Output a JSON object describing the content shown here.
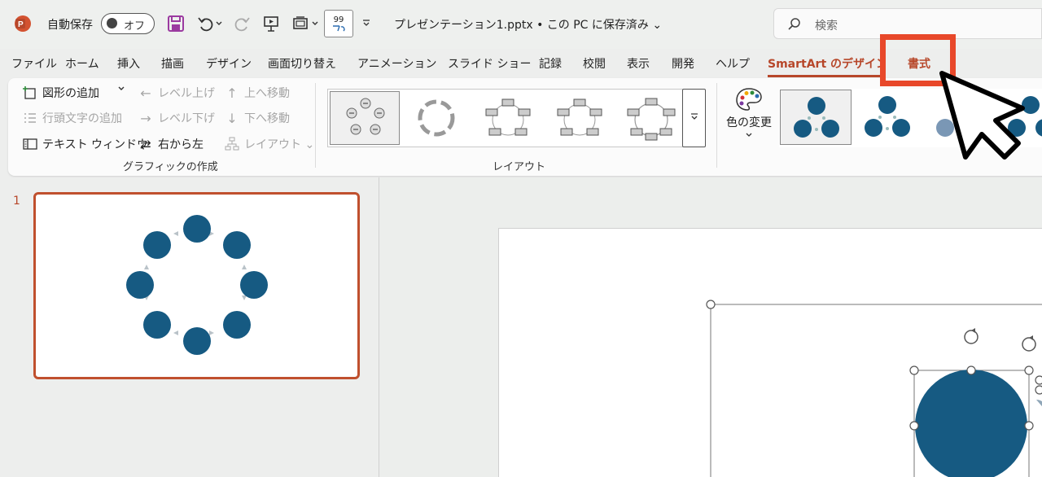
{
  "titlebar": {
    "autosave_label": "自動保存",
    "autosave_state": "オフ",
    "format_painter_label": "99",
    "filename": "プレゼンテーション1.pptx • この PC に保存済み ⌄",
    "search_placeholder": "検索"
  },
  "tabs": [
    {
      "label": "ファイル"
    },
    {
      "label": "ホーム"
    },
    {
      "label": "挿入"
    },
    {
      "label": "描画"
    },
    {
      "label": "デザイン"
    },
    {
      "label": "画面切り替え"
    },
    {
      "label": "アニメーション"
    },
    {
      "label": "スライド ショー"
    },
    {
      "label": "記録"
    },
    {
      "label": "校閲"
    },
    {
      "label": "表示"
    },
    {
      "label": "開発"
    },
    {
      "label": "ヘルプ"
    },
    {
      "label": "SmartArt のデザイン"
    },
    {
      "label": "書式"
    }
  ],
  "ribbon": {
    "create_graphic": {
      "add_shape": "図形の追加",
      "add_bullet": "行頭文字の追加",
      "text_pane": "テキスト ウィンドウ",
      "promote": "レベル上げ",
      "demote": "レベル下げ",
      "right_to_left": "右から左",
      "move_up": "上へ移動",
      "move_down": "下へ移動",
      "layout": "レイアウト ⌄",
      "group_label": "グラフィックの作成"
    },
    "layouts": {
      "group_label": "レイアウト"
    },
    "styles": {
      "change_colors": "色の変更"
    }
  },
  "slides": {
    "current_number": "1"
  },
  "colors": {
    "accent": "#b7472a",
    "highlight": "#e8482a",
    "smartart_fill": "#165a82"
  }
}
